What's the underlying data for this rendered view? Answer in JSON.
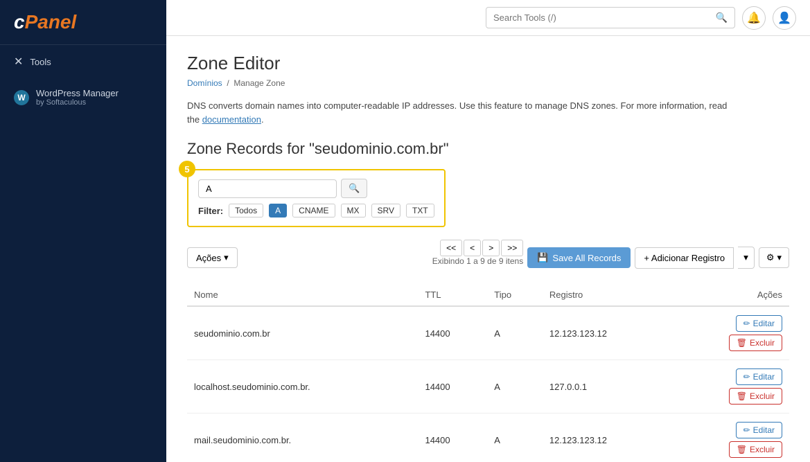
{
  "sidebar": {
    "logo": "cPanel",
    "items": [
      {
        "id": "tools",
        "label": "Tools",
        "icon": "✕"
      }
    ],
    "wordpress": {
      "label": "WordPress Manager",
      "sublabel": "by Softaculous"
    }
  },
  "topbar": {
    "search_placeholder": "Search Tools (/)",
    "search_value": ""
  },
  "page": {
    "title": "Zone Editor",
    "breadcrumb_root": "Domínios",
    "breadcrumb_current": "Manage Zone",
    "description": "DNS converts domain names into computer-readable IP addresses. Use this feature to manage DNS zones. For more information, read the",
    "description_link": "documentation",
    "zone_records_title": "Zone Records for \"seudominio.com.br\"",
    "filter_badge": "5",
    "filter_input_value": "A",
    "filter_label": "Filter:",
    "filter_buttons": [
      {
        "label": "Todos",
        "active": false
      },
      {
        "label": "A",
        "active": true
      },
      {
        "label": "CNAME",
        "active": false
      },
      {
        "label": "MX",
        "active": false
      },
      {
        "label": "SRV",
        "active": false
      },
      {
        "label": "TXT",
        "active": false
      }
    ],
    "pagination_info": "Exibindo 1 a 9 de 9 itens",
    "btn_actions": "Ações",
    "btn_save": "Save All Records",
    "btn_add": "+ Adicionar Registro",
    "table_headers": [
      "Nome",
      "TTL",
      "Tipo",
      "Registro",
      "Ações"
    ],
    "records": [
      {
        "nome": "seudominio.com.br",
        "ttl": "14400",
        "tipo": "A",
        "registro": "12.123.123.12"
      },
      {
        "nome": "localhost.seudominio.com.br.",
        "ttl": "14400",
        "tipo": "A",
        "registro": "127.0.0.1"
      },
      {
        "nome": "mail.seudominio.com.br.",
        "ttl": "14400",
        "tipo": "A",
        "registro": "12.123.123.12"
      }
    ],
    "btn_edit_label": "Editar",
    "btn_delete_label": "Excluir"
  }
}
